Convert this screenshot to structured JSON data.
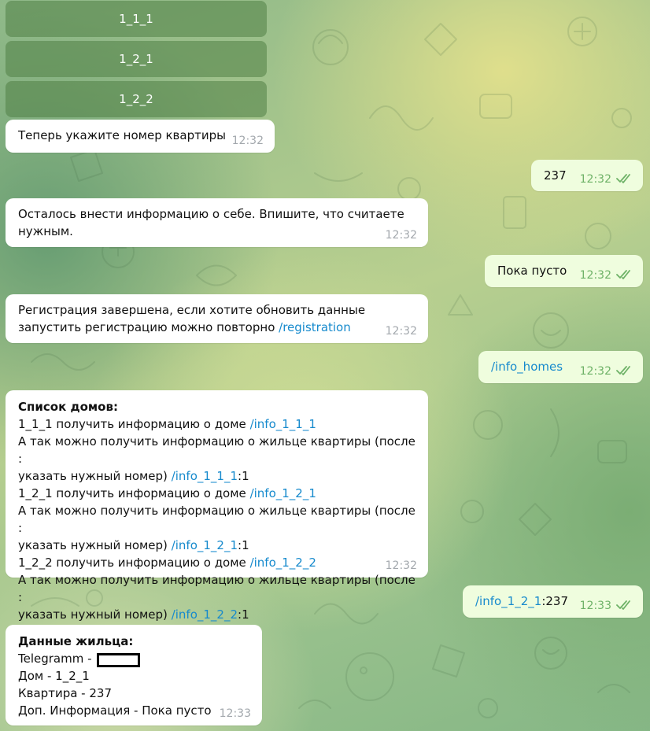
{
  "keyboard": {
    "buttons": [
      "1_1_1",
      "1_2_1",
      "1_2_2"
    ]
  },
  "messages": {
    "m1": {
      "text": "Теперь укажите номер квартиры",
      "time": "12:32"
    },
    "m2": {
      "text": "237",
      "time": "12:32"
    },
    "m3": {
      "line1": "Осталось внести информацию о себе. Впишите, что считаете",
      "line2": "нужным.",
      "time": "12:32"
    },
    "m4": {
      "text": "Пока пусто",
      "time": "12:32"
    },
    "m5": {
      "line1": "Регистрация завершена, если хотите обновить данные",
      "line2_text": "запустить регистрацию можно повторно ",
      "line2_link": "/registration",
      "time": "12:32"
    },
    "m6": {
      "link": "/info_homes",
      "time": "12:32"
    },
    "m7": {
      "title": "Список домов:",
      "house1_text": "1_1_1 получить информацию о доме ",
      "house1_link": "/info_1_1_1",
      "resident_line": "А так можно получить информацию о жильце квартиры (после :",
      "resident1_text": "указать нужный номер) ",
      "resident1_link": "/info_1_1_1",
      "resident1_suffix": ":1",
      "house2_text": "1_2_1 получить информацию о доме ",
      "house2_link": "/info_1_2_1",
      "resident2_text": "указать нужный номер) ",
      "resident2_link": "/info_1_2_1",
      "resident2_suffix": ":1",
      "house3_text": "1_2_2 получить информацию о доме ",
      "house3_link": "/info_1_2_2",
      "resident3_text": "указать нужный номер) ",
      "resident3_link": "/info_1_2_2",
      "resident3_suffix": ":1",
      "time": "12:32"
    },
    "m8": {
      "link": "/info_1_2_1",
      "suffix": ":237",
      "time": "12:33"
    },
    "m9": {
      "title": "Данные жильца:",
      "telegram_label": "Telegramm - ",
      "house_line": "Дом - 1_2_1",
      "flat_line": "Квартира - 237",
      "extra_line": "Доп. Информация - Пока пусто",
      "time": "12:33"
    }
  },
  "colors": {
    "incoming_bubble": "#ffffff",
    "outgoing_bubble": "#effdde",
    "link": "#168acd",
    "outgoing_time": "#6eb267",
    "incoming_time": "#a3a8ad"
  },
  "icons": {
    "read_status": "double-check-icon"
  }
}
